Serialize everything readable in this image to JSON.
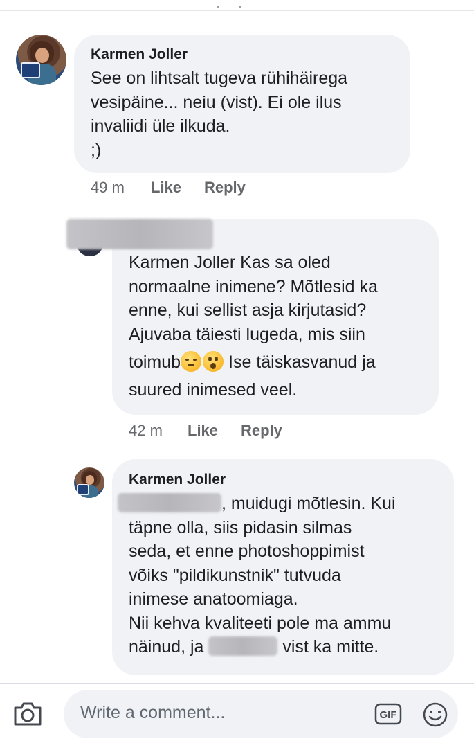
{
  "comments": [
    {
      "author": "Karmen Joller",
      "lines": [
        "See on lihtsalt tugeva rühihäirega",
        "vesipäine... neiu (vist). Ei ole ilus",
        "invaliidi üle ilkuda.",
        ";)"
      ],
      "time": "49 m",
      "like_label": "Like",
      "reply_label": "Reply"
    },
    {
      "lines": [
        "Karmen Joller Kas sa oled",
        "normaalne inimene? Mõtlesid ka",
        "enne, kui sellist asja kirjutasid?",
        "Ajuvaba täiesti lugeda, mis siin",
        "toimub",
        " Ise täiskasvanud ja",
        "suured inimesed veel."
      ],
      "time": "42 m",
      "like_label": "Like",
      "reply_label": "Reply",
      "emoji": [
        "pensive-face",
        "hushed-face"
      ]
    },
    {
      "author": "Karmen Joller",
      "lines": [
        ", muidugi mõtlesin. Kui",
        "täpne olla, siis pidasin silmas",
        "seda, et enne photoshoppimist",
        "võiks \"pildikunstnik\" tutvuda",
        "inimese anatoomiaga.",
        "Nii kehva kvaliteeti pole ma ammu",
        "näinud, ja",
        " vist ka mitte."
      ]
    }
  ],
  "composer": {
    "placeholder": "Write a comment...",
    "gif_label": "GIF"
  },
  "icons": [
    "camera-icon",
    "gif-icon",
    "emoji-icon"
  ]
}
